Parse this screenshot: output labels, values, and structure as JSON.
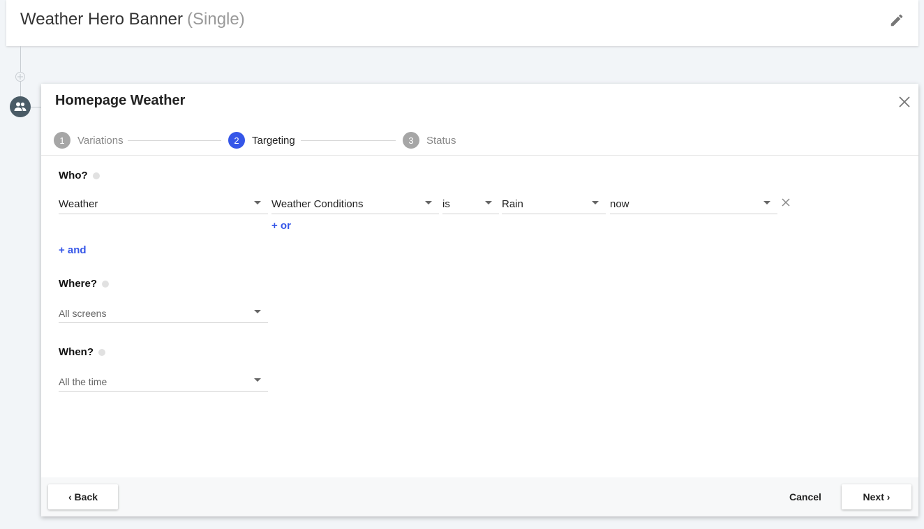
{
  "header": {
    "title": "Weather Hero Banner",
    "subtitle": "(Single)",
    "edit_icon": "pencil-icon"
  },
  "panel": {
    "title": "Homepage Weather",
    "steps": [
      {
        "number": "1",
        "label": "Variations",
        "active": false
      },
      {
        "number": "2",
        "label": "Targeting",
        "active": true
      },
      {
        "number": "3",
        "label": "Status",
        "active": false
      }
    ]
  },
  "who": {
    "label": "Who?",
    "condition": {
      "attribute": "Weather",
      "property": "Weather Conditions",
      "operator": "is",
      "value": "Rain",
      "timeframe": "now"
    },
    "or_link": "+ or",
    "and_link": "+ and"
  },
  "where": {
    "label": "Where?",
    "value": "All screens"
  },
  "when": {
    "label": "When?",
    "value": "All the time"
  },
  "footer": {
    "back": "Back",
    "cancel": "Cancel",
    "next": "Next"
  },
  "colors": {
    "accent": "#3556e8",
    "node": "#4a5b66",
    "background": "#f2f5f8"
  }
}
